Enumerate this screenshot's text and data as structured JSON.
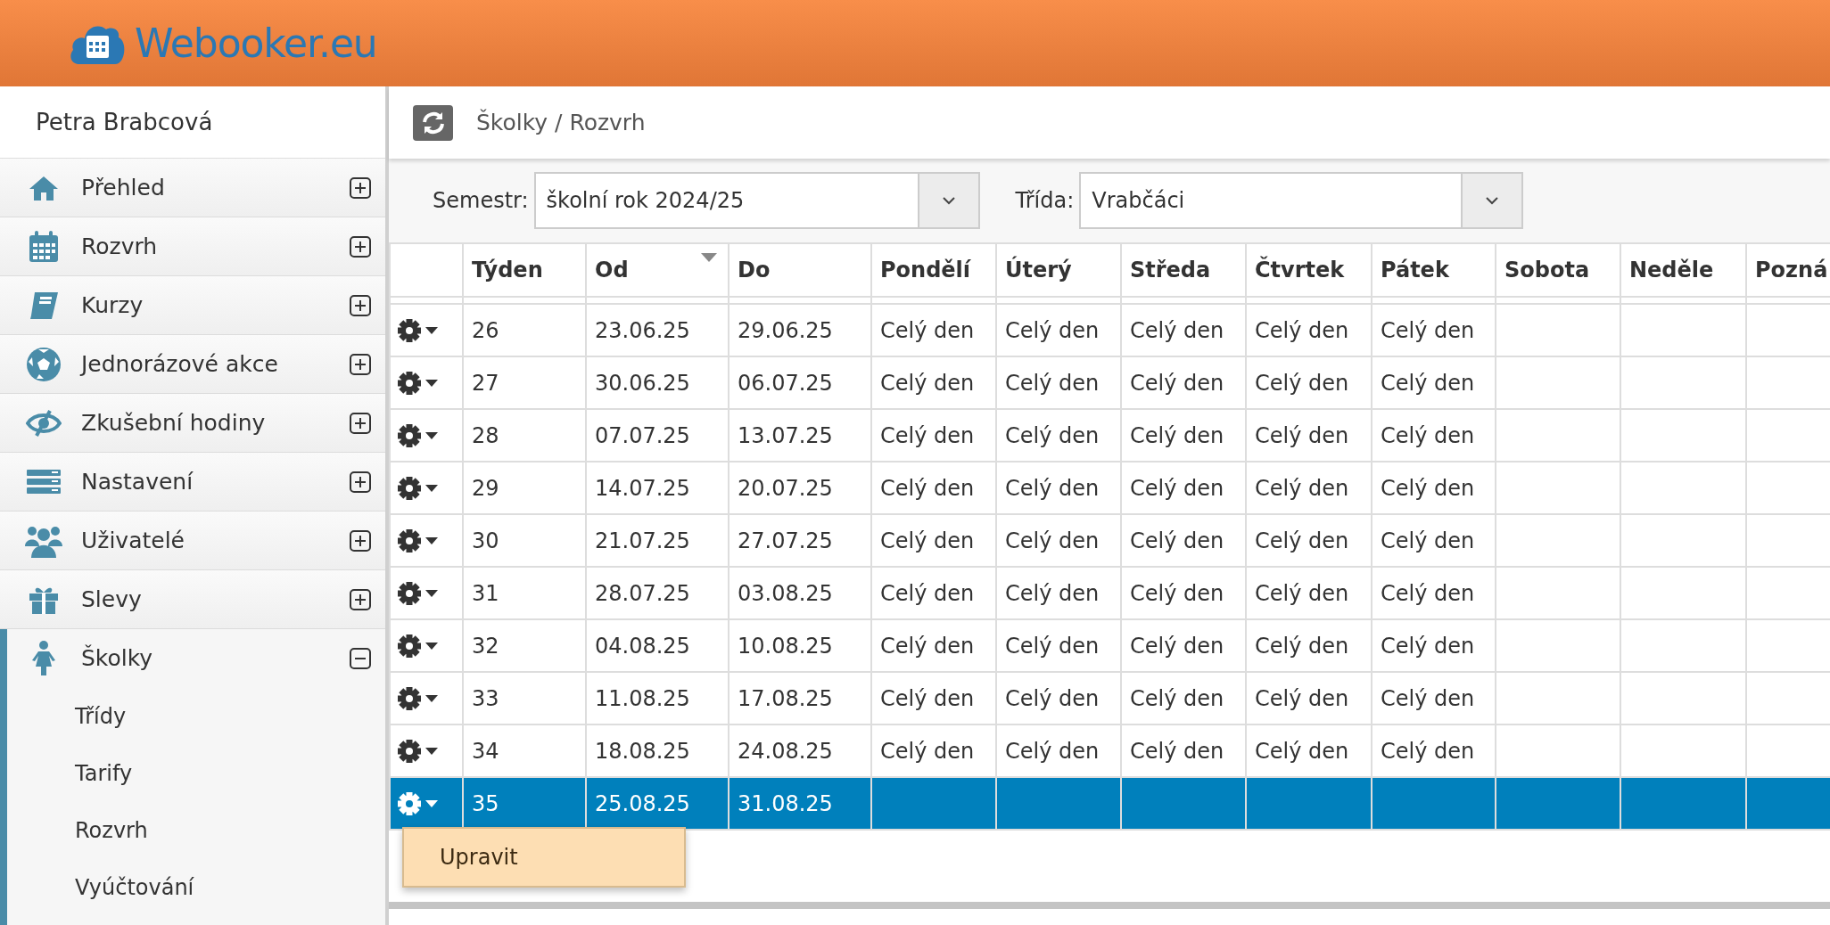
{
  "header": {
    "logo_text": "Webooker.eu"
  },
  "sidebar": {
    "user": "Petra Brabcová",
    "items": [
      {
        "label": "Přehled",
        "expanded": false,
        "selected": false
      },
      {
        "label": "Rozvrh",
        "expanded": false,
        "selected": false
      },
      {
        "label": "Kurzy",
        "expanded": false,
        "selected": false
      },
      {
        "label": "Jednorázové akce",
        "expanded": false,
        "selected": false
      },
      {
        "label": "Zkušební hodiny",
        "expanded": false,
        "selected": false
      },
      {
        "label": "Nastavení",
        "expanded": false,
        "selected": false
      },
      {
        "label": "Uživatelé",
        "expanded": false,
        "selected": false
      },
      {
        "label": "Slevy",
        "expanded": false,
        "selected": false
      },
      {
        "label": "Školky",
        "expanded": true,
        "selected": true,
        "children": [
          {
            "label": "Třídy"
          },
          {
            "label": "Tarify"
          },
          {
            "label": "Rozvrh"
          },
          {
            "label": "Vyúčtování"
          }
        ]
      }
    ]
  },
  "breadcrumb": "Školky / Rozvrh",
  "filters": [
    {
      "label": "Semestr:",
      "value": "školní rok 2024/25"
    },
    {
      "label": "Třída:",
      "value": "Vrabčáci"
    }
  ],
  "table": {
    "columns": [
      {
        "label": "Týden",
        "sorted": false
      },
      {
        "label": "Od",
        "sorted": true
      },
      {
        "label": "Do",
        "sorted": false
      },
      {
        "label": "Pondělí",
        "sorted": false
      },
      {
        "label": "Úterý",
        "sorted": false
      },
      {
        "label": "Středa",
        "sorted": false
      },
      {
        "label": "Čtvrtek",
        "sorted": false
      },
      {
        "label": "Pátek",
        "sorted": false
      },
      {
        "label": "Sobota",
        "sorted": false
      },
      {
        "label": "Neděle",
        "sorted": false
      },
      {
        "label": "Pozná",
        "sorted": false
      }
    ],
    "rows": [
      {
        "week": "26",
        "from": "23.06.25",
        "to": "29.06.25",
        "days": [
          "Celý den",
          "Celý den",
          "Celý den",
          "Celý den",
          "Celý den"
        ],
        "selected": false
      },
      {
        "week": "27",
        "from": "30.06.25",
        "to": "06.07.25",
        "days": [
          "Celý den",
          "Celý den",
          "Celý den",
          "Celý den",
          "Celý den"
        ],
        "selected": false
      },
      {
        "week": "28",
        "from": "07.07.25",
        "to": "13.07.25",
        "days": [
          "Celý den",
          "Celý den",
          "Celý den",
          "Celý den",
          "Celý den"
        ],
        "selected": false
      },
      {
        "week": "29",
        "from": "14.07.25",
        "to": "20.07.25",
        "days": [
          "Celý den",
          "Celý den",
          "Celý den",
          "Celý den",
          "Celý den"
        ],
        "selected": false
      },
      {
        "week": "30",
        "from": "21.07.25",
        "to": "27.07.25",
        "days": [
          "Celý den",
          "Celý den",
          "Celý den",
          "Celý den",
          "Celý den"
        ],
        "selected": false
      },
      {
        "week": "31",
        "from": "28.07.25",
        "to": "03.08.25",
        "days": [
          "Celý den",
          "Celý den",
          "Celý den",
          "Celý den",
          "Celý den"
        ],
        "selected": false
      },
      {
        "week": "32",
        "from": "04.08.25",
        "to": "10.08.25",
        "days": [
          "Celý den",
          "Celý den",
          "Celý den",
          "Celý den",
          "Celý den"
        ],
        "selected": false
      },
      {
        "week": "33",
        "from": "11.08.25",
        "to": "17.08.25",
        "days": [
          "Celý den",
          "Celý den",
          "Celý den",
          "Celý den",
          "Celý den"
        ],
        "selected": false
      },
      {
        "week": "34",
        "from": "18.08.25",
        "to": "24.08.25",
        "days": [
          "Celý den",
          "Celý den",
          "Celý den",
          "Celý den",
          "Celý den"
        ],
        "selected": false
      },
      {
        "week": "35",
        "from": "25.08.25",
        "to": "31.08.25",
        "selected": true
      }
    ]
  },
  "context_menu": {
    "items": [
      "Upravit"
    ]
  }
}
